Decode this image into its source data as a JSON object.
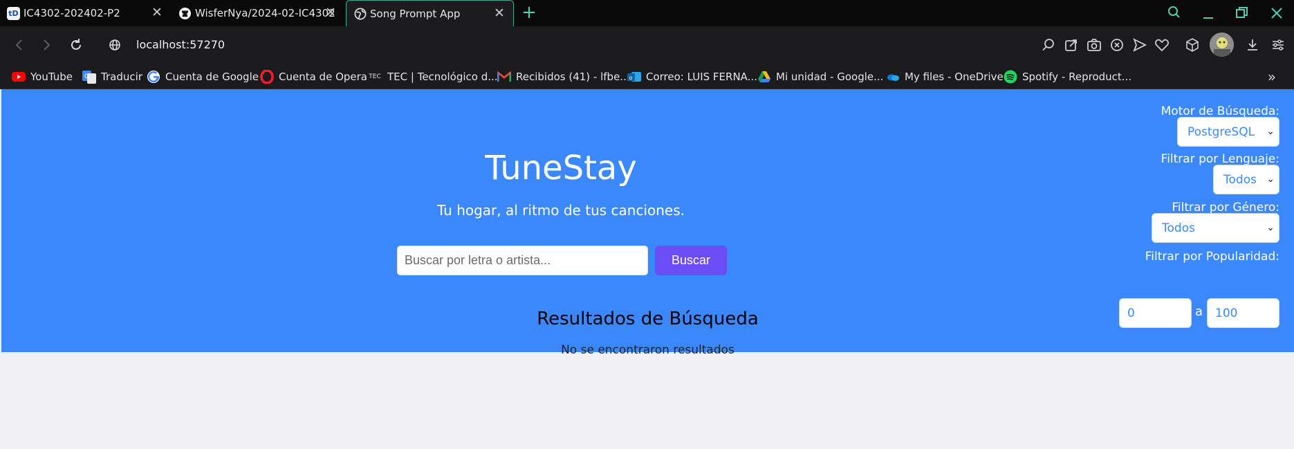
{
  "tabs": [
    {
      "title": "IC4302-202402-P2",
      "favicon": "td-icon"
    },
    {
      "title": "WisferNya/2024-02-IC4302",
      "favicon": "github-icon"
    },
    {
      "title": "Song Prompt App",
      "favicon": "globe-icon",
      "active": true
    }
  ],
  "tab_favicon_td": "tD",
  "address": {
    "url": "localhost:57270"
  },
  "bookmarks": [
    {
      "label": "YouTube",
      "icon": "youtube-icon"
    },
    {
      "label": "Traducir",
      "icon": "translate-icon"
    },
    {
      "label": "Cuenta de Google",
      "icon": "google-icon"
    },
    {
      "label": "Cuenta de Opera",
      "icon": "opera-icon"
    },
    {
      "label": "TEC | Tecnológico d...",
      "icon": "tec-icon"
    },
    {
      "label": "Recibidos (41) - lfbe...",
      "icon": "gmail-icon"
    },
    {
      "label": "Correo: LUIS FERNA...",
      "icon": "outlook-icon"
    },
    {
      "label": "Mi unidad - Google...",
      "icon": "drive-icon"
    },
    {
      "label": "My files - OneDrive",
      "icon": "onedrive-icon"
    },
    {
      "label": "Spotify - Reproduct...",
      "icon": "spotify-icon"
    }
  ],
  "tec_icon_text": "TEC",
  "hero": {
    "title": "TuneStay",
    "subtitle": "Tu hogar, al ritmo de tus canciones.",
    "search_placeholder": "Buscar por letra o artista...",
    "search_button": "Buscar"
  },
  "filters": {
    "engine_label": "Motor de Búsqueda:",
    "engine_value": "PostgreSQL",
    "language_label": "Filtrar por Lenguaje:",
    "language_value": "Todos",
    "genre_label": "Filtrar por Género:",
    "genre_value": "Todos",
    "popularity_label": "Filtrar por Popularidad:",
    "popularity_min": "0",
    "popularity_sep": "a",
    "popularity_max": "100"
  },
  "results": {
    "title": "Resultados de Búsqueda",
    "empty_message": "No se encontraron resultados"
  },
  "colors": {
    "hero_bg": "#3b88fc",
    "button_bg": "#6b4df6",
    "page_bg": "#f0eff4",
    "tab_accent": "#37b39b"
  }
}
